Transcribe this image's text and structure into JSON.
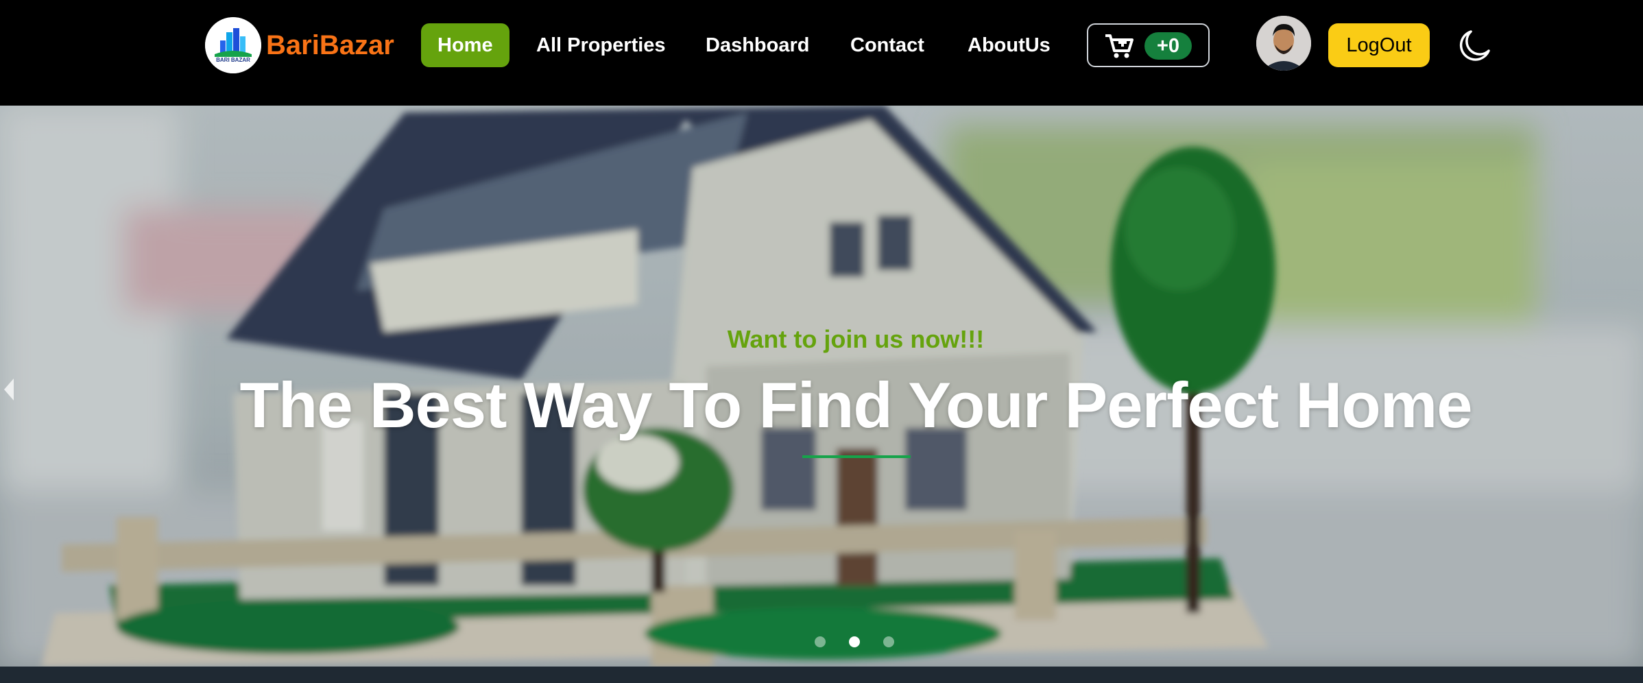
{
  "brand": {
    "name": "BariBazar",
    "logo_text": "BARI BAZAR",
    "color": "#f97316"
  },
  "nav": {
    "items": [
      {
        "label": "Home",
        "active": true
      },
      {
        "label": "All Properties",
        "active": false
      },
      {
        "label": "Dashboard",
        "active": false
      },
      {
        "label": "Contact",
        "active": false
      },
      {
        "label": "AboutUs",
        "active": false
      }
    ],
    "active_color": "#65a30d"
  },
  "cart": {
    "icon": "cart-plus-icon",
    "count_label": "+0",
    "badge_color": "#15803d"
  },
  "user": {
    "avatar_icon": "user-avatar",
    "logout_label": "LogOut",
    "logout_color": "#facc15"
  },
  "theme_toggle": {
    "icon": "moon-icon"
  },
  "hero": {
    "eyebrow": "Want to join us now!!!",
    "headline": "The Best Way To Find Your Perfect Home",
    "accent_color": "#65a30d",
    "underline_color": "#16a34a",
    "background": "house-model-photo",
    "prev_icon": "chevron-left-icon",
    "slides": 3,
    "active_slide": 2
  }
}
